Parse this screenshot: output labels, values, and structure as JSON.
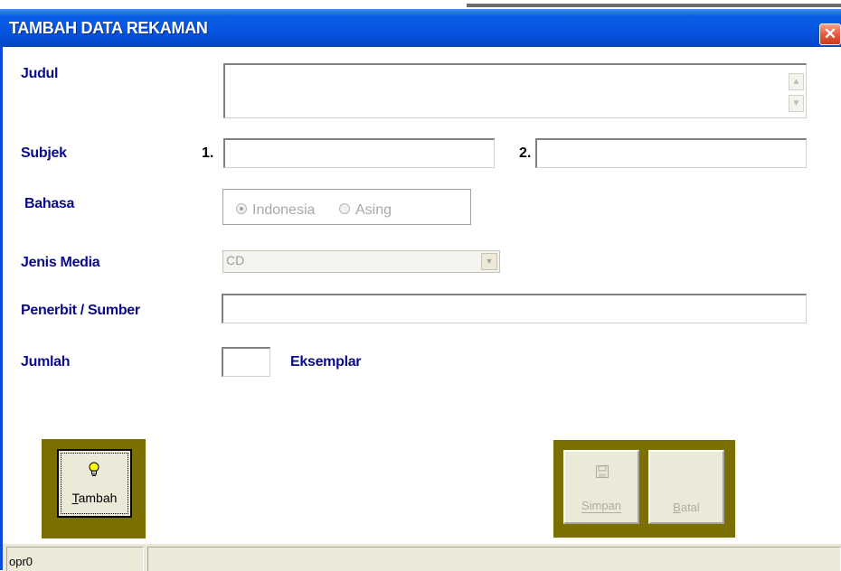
{
  "window": {
    "title": "TAMBAH DATA REKAMAN",
    "close_glyph": "✕"
  },
  "form": {
    "judul_label": "Judul",
    "judul_value": "",
    "subjek_label": "Subjek",
    "subjek_1_num": "1.",
    "subjek_1_value": "",
    "subjek_2_num": "2.",
    "subjek_2_value": "",
    "bahasa_label": "Bahasa",
    "bahasa_options": [
      "Indonesia",
      "Asing"
    ],
    "bahasa_selected": "Indonesia",
    "jenis_media_label": "Jenis Media",
    "jenis_media_value": "CD",
    "penerbit_label": "Penerbit / Sumber",
    "penerbit_value": "",
    "jumlah_label": "Jumlah",
    "jumlah_value": "",
    "eksemplar_label": "Eksemplar"
  },
  "buttons": {
    "tambah": {
      "label": "Tambah",
      "mnemonic": "T",
      "icon": "lightbulb-icon",
      "enabled": true
    },
    "simpan": {
      "label": "Simpan",
      "mnemonic": "S",
      "icon": "floppy-disk-icon",
      "enabled": false
    },
    "batal": {
      "label": "Batal",
      "mnemonic": "B",
      "enabled": false
    }
  },
  "statusbar": {
    "panel1": "opr0",
    "panel2": ""
  },
  "colors": {
    "titlebar": "#0553df",
    "label_text": "#0a0a8a",
    "button_frame": "#7a6f00",
    "close_button": "#e2563a"
  }
}
